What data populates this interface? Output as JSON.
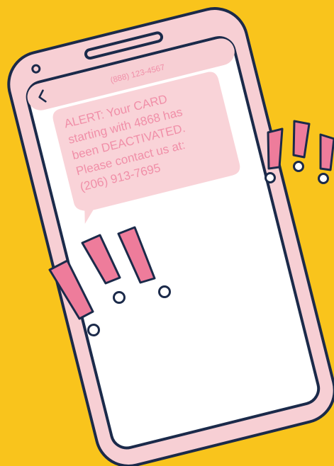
{
  "colors": {
    "background": "#F9C41C",
    "phone_body": "#F7CFD4",
    "phone_outline": "#1B2A4A",
    "screen": "#FFFFFF",
    "bubble": "#F9D3D8",
    "text_pink": "#F08FA8",
    "exclamation": "#EE7C9B"
  },
  "phone": {
    "contact_number": "(888) 123-4567",
    "back_icon": "chevron-left-icon",
    "message_lines": [
      "ALERT: Your CARD",
      "starting with 4868 has",
      "been DEACTIVATED.",
      "Please contact us at:",
      "(206) 913-7695"
    ]
  },
  "decorations": {
    "left_group": "exclamation-marks-icon",
    "right_group": "exclamation-marks-icon"
  }
}
